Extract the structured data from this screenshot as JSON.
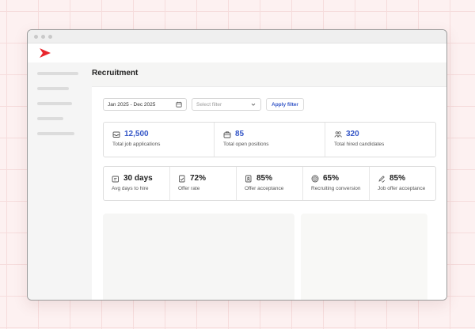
{
  "page": {
    "title": "Recruitment"
  },
  "filters": {
    "date_range": "Jan 2025 - Dec 2025",
    "select_placeholder": "Select filter",
    "apply_label": "Apply filter"
  },
  "summary": [
    {
      "value": "12,500",
      "label": "Total job applications",
      "icon": "inbox-icon"
    },
    {
      "value": "85",
      "label": "Total open positions",
      "icon": "briefcase-icon"
    },
    {
      "value": "320",
      "label": "Total hired candidates",
      "icon": "people-icon"
    }
  ],
  "metrics": [
    {
      "value": "30 days",
      "label": "Avg days to hire",
      "icon": "calendar-edit-icon"
    },
    {
      "value": "72%",
      "label": "Offer rate",
      "icon": "document-check-icon"
    },
    {
      "value": "85%",
      "label": "Offer acceptance",
      "icon": "document-user-icon"
    },
    {
      "value": "65%",
      "label": "Recruiting conversion",
      "icon": "target-icon"
    },
    {
      "value": "85%",
      "label": "Job offer acceptance",
      "icon": "pen-check-icon"
    }
  ],
  "colors": {
    "accent": "#3456c7",
    "brand": "#e8262c"
  }
}
